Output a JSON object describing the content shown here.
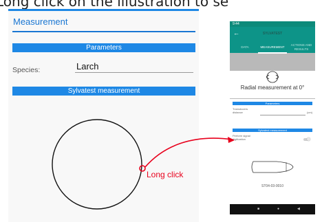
{
  "caption": "Long click on the illustration to se",
  "form": {
    "heading": "Measurement",
    "parameters_band": "Parameters",
    "species_label": "Species:",
    "species_value": "Larch",
    "sylvatest_band": "Sylvatest measurement",
    "long_click_label": "Long click"
  },
  "phone": {
    "status_time": "9:44",
    "app_title": "SYLVATEST",
    "tabs": [
      {
        "label": "DATA",
        "active": false
      },
      {
        "label": "MEASUREMENT",
        "active": true
      },
      {
        "label": "ACTIONS AND\nRESULTS",
        "active": false
      }
    ],
    "radial_text": "Radial measurement at 0°",
    "parameters_band": "Parameters",
    "transducers_label": "Transducers\ndistance",
    "unit": "(cm)",
    "sylvatest_band": "Sylvatest measurement",
    "signal_label": "Perform signal\ndigitization",
    "serial": "ST04-03-0010",
    "nav_icons": [
      "square-icon",
      "circle-icon",
      "triangle-back-icon"
    ]
  },
  "colors": {
    "accent_blue": "#1e88e5",
    "teal": "#0d9488",
    "highlight_red": "#e8001c"
  }
}
